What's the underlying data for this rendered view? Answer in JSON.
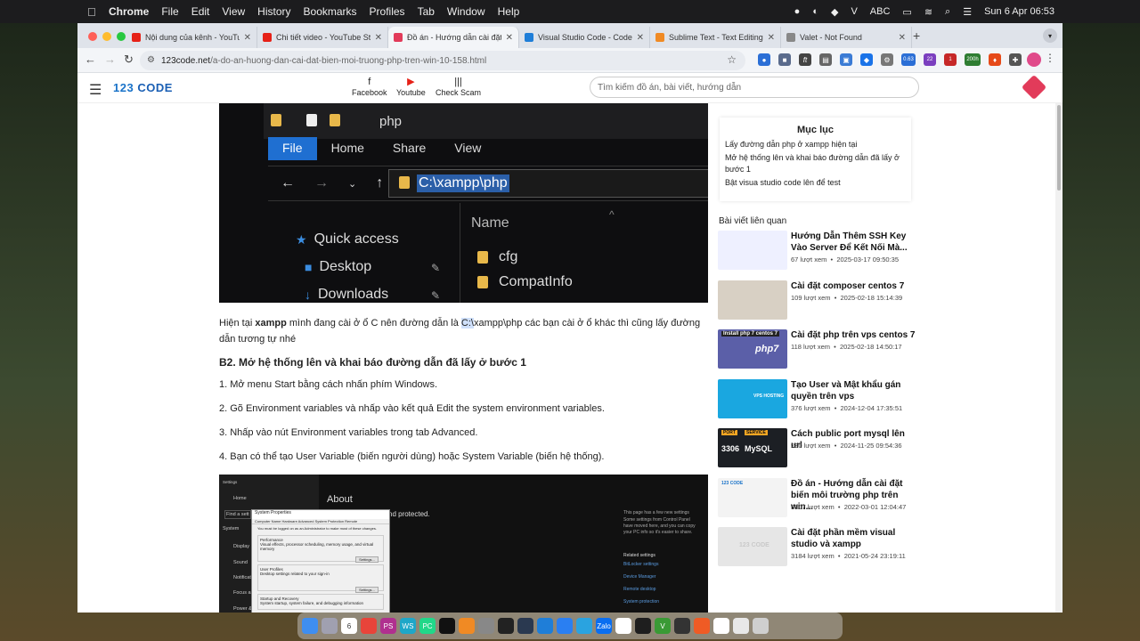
{
  "menubar": {
    "app": "Chrome",
    "items": [
      "File",
      "Edit",
      "View",
      "History",
      "Bookmarks",
      "Profiles",
      "Tab",
      "Window",
      "Help"
    ],
    "abc": "ABC",
    "clock": "Sun 6 Apr  06:53"
  },
  "tabs": [
    {
      "title": "Nội dung của kênh - YouTube",
      "fav_color": "#e62117"
    },
    {
      "title": "Chi tiết video - YouTube Studio",
      "fav_color": "#e62117"
    },
    {
      "title": "Đồ án - Hướng dẫn cài đặt biến",
      "fav_color": "#e23b5a"
    },
    {
      "title": "Visual Studio Code - Code Ed",
      "fav_color": "#1f7ed8"
    },
    {
      "title": "Sublime Text - Text Editing, D",
      "fav_color": "#f08a24"
    },
    {
      "title": "Valet - Not Found",
      "fav_color": "#888888"
    }
  ],
  "omnibox": {
    "domain": "123code.net",
    "path": "/a-do-an-huong-dan-cai-dat-bien-moi-truong-php-tren-win-10-158.html"
  },
  "extensions": {
    "badge1": "0.63",
    "badge2": "22",
    "badge3": "1",
    "badge4": "200h"
  },
  "site": {
    "logo_num": "123",
    "logo_text": "CODE",
    "nav": [
      {
        "label": "Facebook",
        "icon": "f"
      },
      {
        "label": "Youtube",
        "icon": "▶"
      },
      {
        "label": "Check Scam",
        "icon": "|||"
      }
    ],
    "search_placeholder": "Tìm kiếm đồ án, bài viết, hướng dẫn"
  },
  "hero_screenshot": {
    "folder_title": "php",
    "ribbon": [
      "File",
      "Home",
      "Share",
      "View"
    ],
    "path": "C:\\xampp\\php",
    "name_header": "Name",
    "nav_items": [
      "Quick access",
      "Desktop",
      "Downloads"
    ],
    "files": [
      "cfg",
      "CompatInfo"
    ]
  },
  "article": {
    "p1_pre": "Hiện tại ",
    "p1_bold": "xampp",
    "p1_mid": " mình đang cài ở ổ C nên đường dẫn là ",
    "p1_hl": "C:\\",
    "p1_post": "xampp\\php các bạn cài ở ổ khác thì cũng lấy đường dẫn tương tự nhé",
    "h2": "B2. Mở hệ thống lên và khai báo đường dẫn đã lấy ở bước 1",
    "steps": [
      "1. Mở menu Start bằng cách nhấn phím Windows.",
      "2. Gõ Environment variables và nhấp vào kết quả Edit the system environment variables.",
      "3. Nhấp vào nút Environment variables trong tab Advanced.",
      "4. Bạn có thể tạo User Variable (biến người dùng) hoặc System Variable (biến hệ thống)."
    ]
  },
  "settings_screenshot": {
    "about": "About",
    "protected": "nd protected.",
    "dialog_title": "System Properties",
    "dialog_tabs": "Computer Name   Hardware   Advanced   System Protection   Remote",
    "admin_note": "You must be logged on as an Administrator to make most of these changes.",
    "performance": "Performance",
    "perf_desc": "Visual effects, processor scheduling, memory usage, and virtual memory",
    "user_profiles": "User Profiles",
    "profiles_desc": "Desktop settings related to your sign-in",
    "startup": "Startup and Recovery",
    "startup_desc": "System startup, system failure, and debugging information",
    "settings_btn": "Settings...",
    "side_items": [
      "Home",
      "System",
      "Display",
      "Sound",
      "Notificati",
      "Focus assi",
      "Power &"
    ],
    "find": "Find a sett",
    "right_text": [
      "This page has a few new settings",
      "Some settings from Control Panel",
      "have moved here, and you can copy",
      "your PC info so it's easier to share."
    ],
    "related_title": "Related settings",
    "right_links": [
      "BitLocker settings",
      "Device Manager",
      "Remote desktop",
      "System protection"
    ]
  },
  "sidebar": {
    "toc_title": "Mục lục",
    "toc_items": [
      "Lấy đường dẫn php ở xampp hiện tại",
      "Mở hệ thống lên và khai báo đường dẫn đã lấy ở bước 1",
      "Bật visua studio code lên để test"
    ],
    "related_title": "Bài viết liên quan",
    "related": [
      {
        "title": "Hướng Dẫn Thêm SSH Key Vào Server Để Kết Nối Mà...",
        "views": "67 lượt xem",
        "date": "2025-03-17 09:50:35",
        "thumb": "#eef0ff"
      },
      {
        "title": "Cài đặt composer centos 7",
        "views": "109 lượt xem",
        "date": "2025-02-18 15:14:39",
        "thumb": "#d8d0c4"
      },
      {
        "title": "Cài đặt php trên vps centos 7",
        "views": "118 lượt xem",
        "date": "2025-02-18 14:50:17",
        "thumb": "#5b5fa8"
      },
      {
        "title": "Tạo User và Mật khẩu gán quyền trên vps",
        "views": "376 lượt xem",
        "date": "2024-12-04 17:35:51",
        "thumb": "#1aa7e0"
      },
      {
        "title": "Cách public port mysql lên url",
        "views": "280 lượt xem",
        "date": "2024-11-25 09:54:36",
        "thumb": "#1c1f24"
      },
      {
        "title": "Đồ án - Hướng dẫn cài đặt biến môi trường php trên win...",
        "views": "3307 lượt xem",
        "date": "2022-03-01 12:04:47",
        "thumb": "#f3f3f3"
      },
      {
        "title": "Cài đặt phần mềm visual studio và xampp",
        "views": "3184 lượt xem",
        "date": "2021-05-24 23:19:11",
        "thumb": "#e6e6e6"
      }
    ],
    "thumb_labels": {
      "t1a": "Install php 7 centos 7",
      "t2a": "php7",
      "t3": "VPS HOSTING",
      "t4a": "PORT",
      "t4b": "3306",
      "t4c": "SERVICE",
      "t4d": "MySQL",
      "t5": "123 CODE",
      "t6": "123 CODE"
    }
  },
  "dock": [
    {
      "name": "finder-icon",
      "color": "#3f8ef0"
    },
    {
      "name": "launchpad-icon",
      "color": "#a0a0b0"
    },
    {
      "name": "calendar-icon",
      "color": "#ffffff",
      "label": "6"
    },
    {
      "name": "chrome-icon",
      "color": "#e8443a"
    },
    {
      "name": "phpstorm-icon",
      "color": "#b0308f",
      "label": "PS"
    },
    {
      "name": "webstorm-icon",
      "color": "#1fa7c8",
      "label": "WS"
    },
    {
      "name": "pycharm-icon",
      "color": "#21d789",
      "label": "PC"
    },
    {
      "name": "cursor-icon",
      "color": "#111111"
    },
    {
      "name": "sublime-icon",
      "color": "#f08a24"
    },
    {
      "name": "sequel-icon",
      "color": "#888888"
    },
    {
      "name": "terminal-icon",
      "color": "#222222"
    },
    {
      "name": "navicat-icon",
      "color": "#2a3950"
    },
    {
      "name": "vscode-icon",
      "color": "#1f7ed8"
    },
    {
      "name": "messenger-icon",
      "color": "#2a7ff2"
    },
    {
      "name": "telegram-icon",
      "color": "#2aa3e0"
    },
    {
      "name": "zalo-icon",
      "color": "#0a6ef0",
      "label": "Zalo"
    },
    {
      "name": "chatgpt-icon",
      "color": "#ffffff"
    },
    {
      "name": "activity-icon",
      "color": "#1e1e1e"
    },
    {
      "name": "vim-icon",
      "color": "#3a9a35",
      "label": "V"
    },
    {
      "name": "compass-icon",
      "color": "#333333"
    },
    {
      "name": "postman-icon",
      "color": "#ef5b25"
    },
    {
      "name": "doc-icon",
      "color": "#ffffff"
    },
    {
      "name": "preview-icon",
      "color": "#e8e8e8"
    },
    {
      "name": "trash-icon",
      "color": "#cfcfcf"
    }
  ]
}
